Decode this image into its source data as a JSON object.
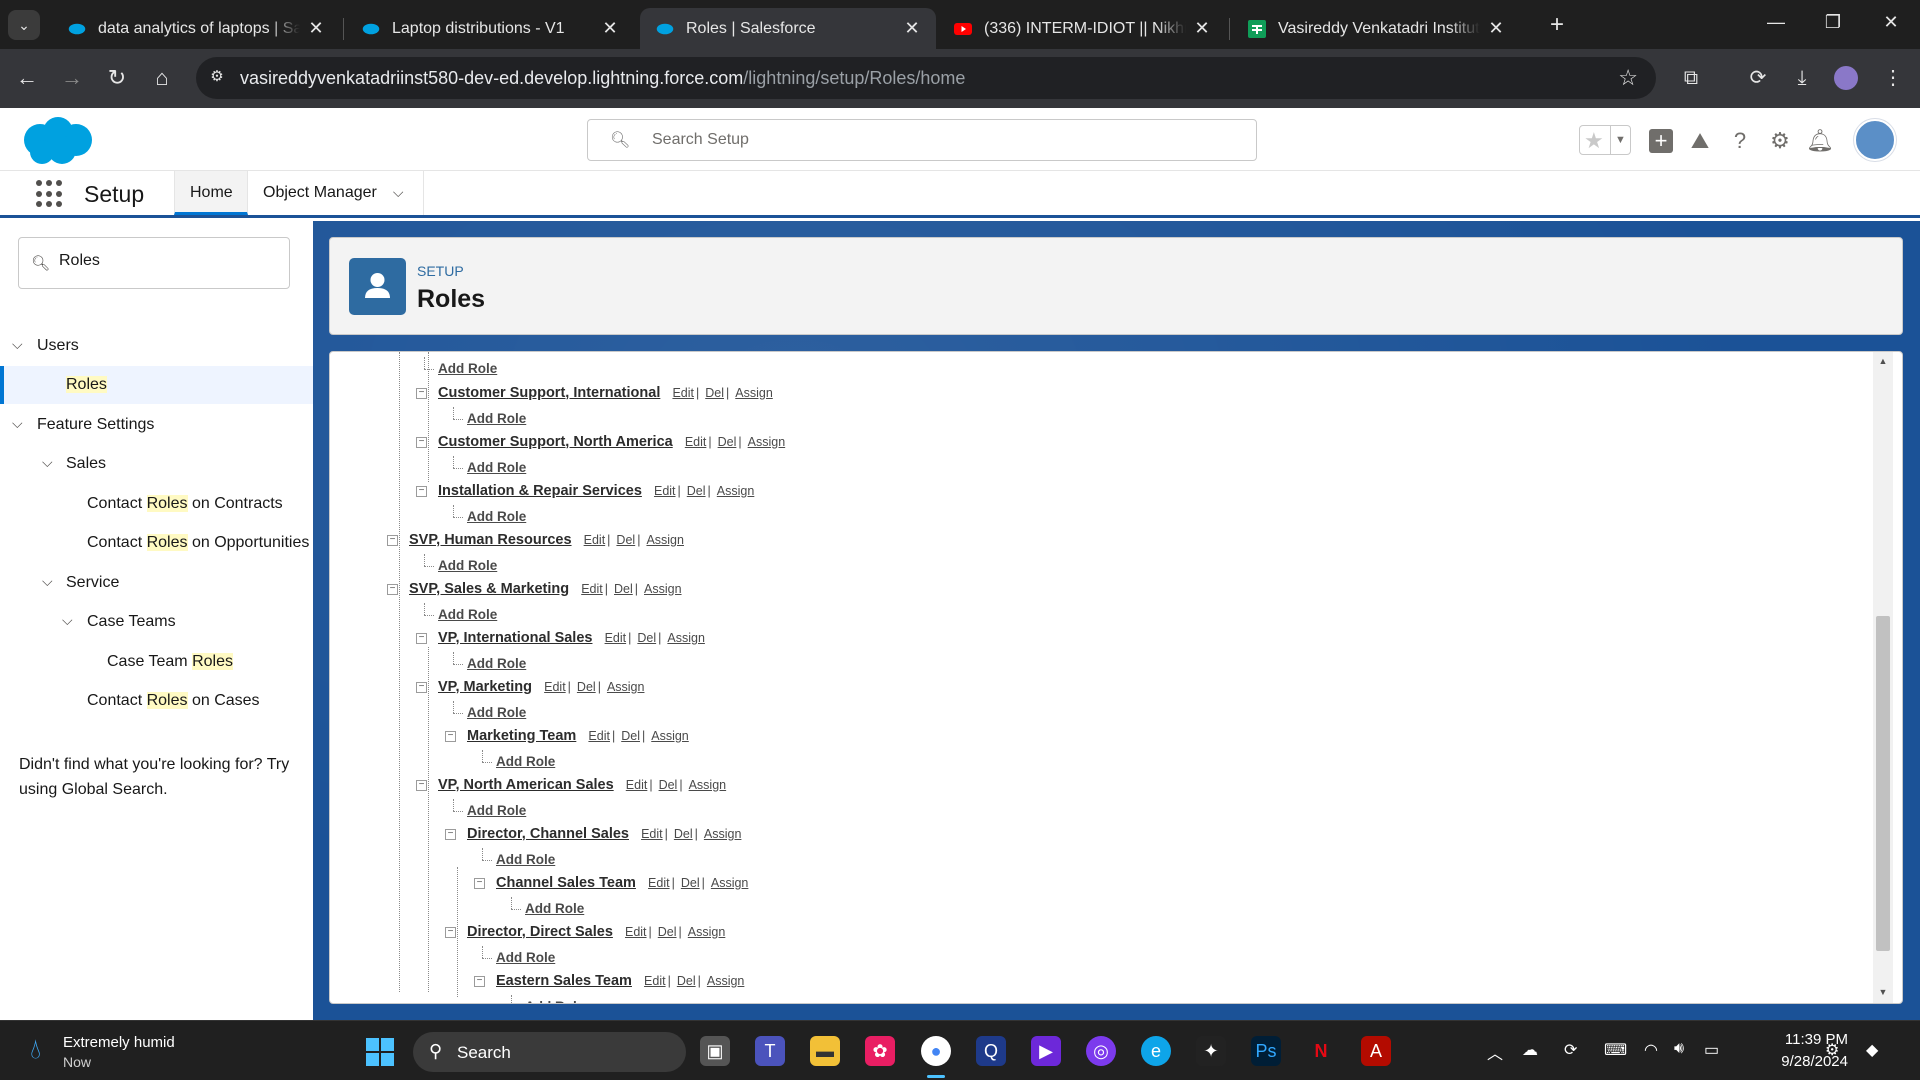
{
  "browser": {
    "tabs": [
      {
        "title": "data analytics of laptops | Salesf",
        "favicon": "salesforce-cloud",
        "active": false
      },
      {
        "title": "Laptop distributions - V1",
        "favicon": "salesforce-cloud",
        "active": false
      },
      {
        "title": "Roles | Salesforce",
        "favicon": "salesforce-cloud",
        "active": true
      },
      {
        "title": "(336) INTERM-IDIOT || Nikhil || St",
        "favicon": "youtube-icon",
        "active": false
      },
      {
        "title": "Vasireddy Venkatadri Institute O",
        "favicon": "google-sheets-icon",
        "active": false
      }
    ],
    "url_host": "vasireddyvenkatadriinst580-dev-ed.develop.lightning.force.com",
    "url_path": "/lightning/setup/Roles/home"
  },
  "header": {
    "search_placeholder": "Search Setup"
  },
  "nav": {
    "app_name": "Setup",
    "tabs": [
      {
        "label": "Home",
        "active": true
      },
      {
        "label": "Object Manager",
        "active": false
      }
    ]
  },
  "sidebar": {
    "quickfind_value": "Roles",
    "items": [
      {
        "label": "Users",
        "level": 0,
        "expanded": true
      },
      {
        "label": "Roles",
        "level": 1,
        "selected": true
      },
      {
        "label": "Feature Settings",
        "level": 0,
        "expanded": true
      },
      {
        "label": "Sales",
        "level": 1,
        "expanded": true
      },
      {
        "label": "Contact Roles on Contracts",
        "level": 2
      },
      {
        "label": "Contact Roles on Opportunities",
        "level": 2
      },
      {
        "label": "Service",
        "level": 1,
        "expanded": true
      },
      {
        "label": "Case Teams",
        "level": 2,
        "expanded": true
      },
      {
        "label": "Case Team Roles",
        "level": 3
      },
      {
        "label": "Contact Roles on Cases",
        "level": 2
      }
    ],
    "help_text": "Didn't find what you're looking for? Try using Global Search."
  },
  "page": {
    "eyebrow": "SETUP",
    "title": "Roles"
  },
  "role_tree": {
    "add_role_label": "Add Role",
    "actions": [
      "Edit",
      "Del",
      "Assign"
    ],
    "roles": [
      {
        "name": "Customer Support, International",
        "depth": 2
      },
      {
        "name": "Customer Support, North America",
        "depth": 2
      },
      {
        "name": "Installation & Repair Services",
        "depth": 2
      },
      {
        "name": "SVP, Human Resources",
        "depth": 1
      },
      {
        "name": "SVP, Sales & Marketing",
        "depth": 1
      },
      {
        "name": "VP, International Sales",
        "depth": 2
      },
      {
        "name": "VP, Marketing",
        "depth": 2
      },
      {
        "name": "Marketing Team",
        "depth": 3
      },
      {
        "name": "VP, North American Sales",
        "depth": 2
      },
      {
        "name": "Director, Channel Sales",
        "depth": 3
      },
      {
        "name": "Channel Sales Team",
        "depth": 4
      },
      {
        "name": "Director, Direct Sales",
        "depth": 3
      },
      {
        "name": "Eastern Sales Team",
        "depth": 4
      }
    ]
  },
  "taskbar": {
    "weather_title": "Extremely humid",
    "weather_sub": "Now",
    "search_label": "Search",
    "time": "11:39 PM",
    "date": "9/28/2024"
  },
  "colors": {
    "salesforce_blue": "#0176d3",
    "setup_background": "#1b5297",
    "chrome_dark": "#35363a"
  }
}
